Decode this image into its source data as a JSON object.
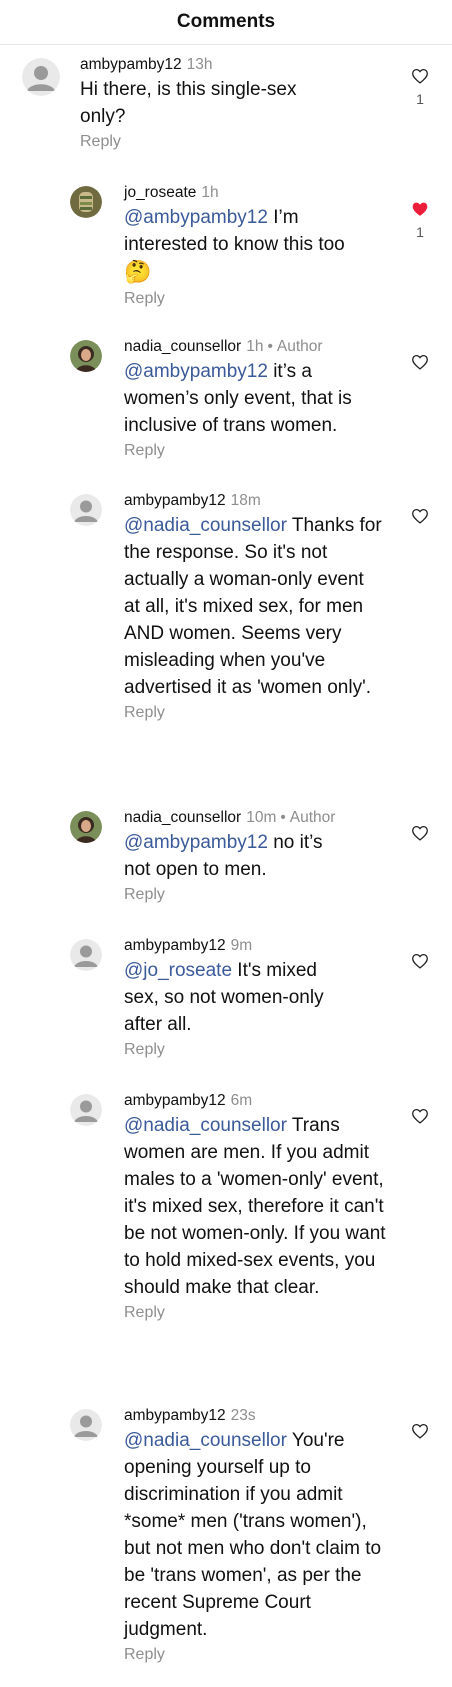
{
  "header": {
    "title": "Comments"
  },
  "comments": [
    {
      "username": "ambypamby12",
      "time": "13h",
      "author_badge": "",
      "mention": "",
      "text": "Hi there, is this single-sex only?",
      "reply_label": "Reply",
      "liked": false,
      "like_count": "1"
    },
    {
      "username": "jo_roseate",
      "time": "1h",
      "author_badge": "",
      "mention": "@ambypamby12",
      "text": " I’m interested to know this too",
      "emoji": "🤔",
      "reply_label": "Reply",
      "liked": true,
      "like_count": "1"
    },
    {
      "username": "nadia_counsellor",
      "time": "1h",
      "author_badge": "Author",
      "mention": "@ambypamby12",
      "text": " it’s a women’s only event, that is inclusive of trans women.",
      "reply_label": "Reply",
      "liked": false,
      "like_count": ""
    },
    {
      "username": "ambypamby12",
      "time": "18m",
      "author_badge": "",
      "mention": "@nadia_counsellor",
      "text": " Thanks for the response. So it's not actually a woman-only event at all, it's mixed sex, for men AND women. Seems very misleading when you've advertised it as 'women only'.",
      "reply_label": "Reply",
      "liked": false,
      "like_count": ""
    },
    {
      "username": "nadia_counsellor",
      "time": "10m",
      "author_badge": "Author",
      "mention": "@ambypamby12",
      "text": " no it’s not open to men.",
      "reply_label": "Reply",
      "liked": false,
      "like_count": ""
    },
    {
      "username": "ambypamby12",
      "time": "9m",
      "author_badge": "",
      "mention": "@jo_roseate",
      "text": " It's mixed sex, so not women-only after all.",
      "reply_label": "Reply",
      "liked": false,
      "like_count": ""
    },
    {
      "username": "ambypamby12",
      "time": "6m",
      "author_badge": "",
      "mention": "@nadia_counsellor",
      "text": " Trans women are men. If you admit males to a 'women-only' event, it's mixed sex, therefore it can't be not women-only. If you want to hold mixed-sex events, you should make that clear.",
      "reply_label": "Reply",
      "liked": false,
      "like_count": ""
    },
    {
      "username": "ambypamby12",
      "time": "23s",
      "author_badge": "",
      "mention": "@nadia_counsellor",
      "text": " You're opening yourself up to discrimination if you admit *some* men ('trans women'), but not men who don't claim to be 'trans women', as per the recent Supreme Court judgment.",
      "reply_label": "Reply",
      "liked": false,
      "like_count": ""
    }
  ],
  "colors": {
    "mention": "#3b5a9a",
    "liked_heart": "#ed1c3a",
    "muted": "#8e8e8e"
  },
  "icons": {
    "like": "heart-outline-icon",
    "liked": "heart-filled-icon",
    "avatar_default": "default-avatar-icon"
  }
}
